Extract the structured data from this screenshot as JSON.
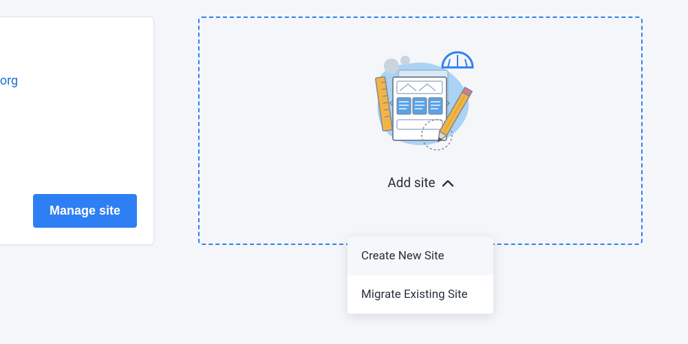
{
  "existing_site": {
    "domain_fragment": "g.org",
    "manage_label": "Manage site"
  },
  "add_site": {
    "label": "Add site",
    "menu": {
      "create": "Create New Site",
      "migrate": "Migrate Existing Site"
    }
  }
}
